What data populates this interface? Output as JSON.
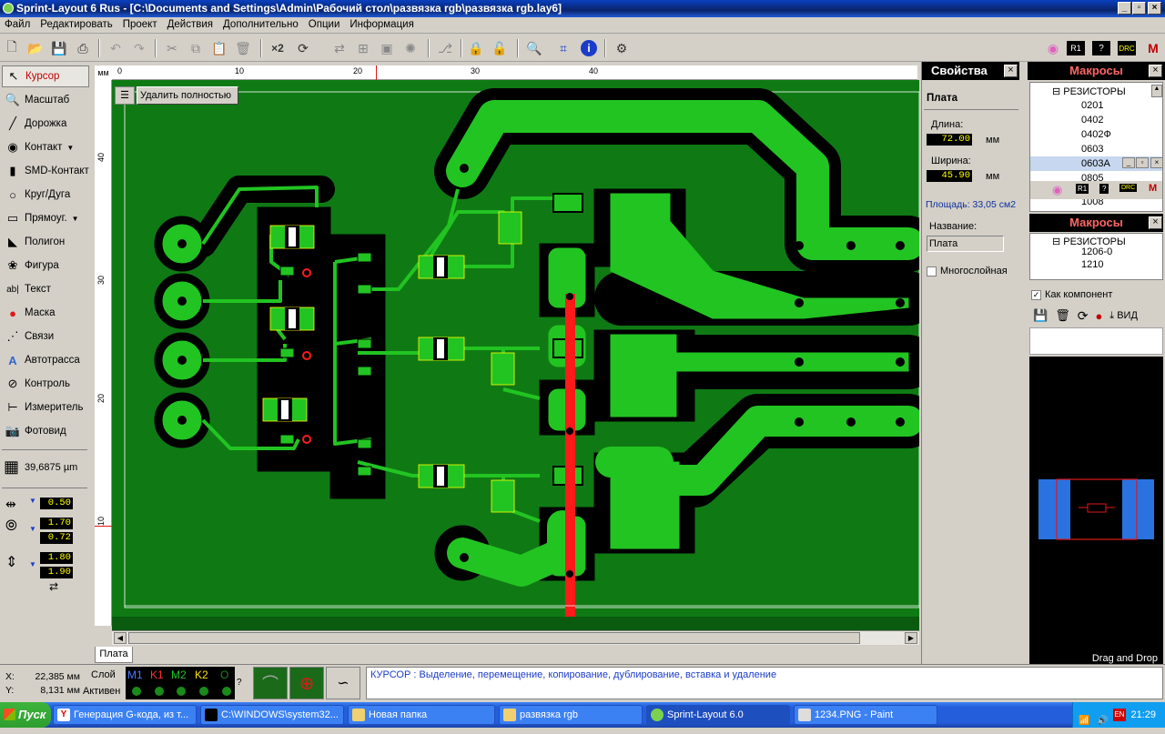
{
  "window": {
    "title": "Sprint-Layout 6 Rus - [C:\\Documents and Settings\\Admin\\Рабочий стол\\развязка rgb\\развязка rgb.lay6]"
  },
  "menu": [
    "Файл",
    "Редактировать",
    "Проект",
    "Действия",
    "Дополнительно",
    "Опции",
    "Информация"
  ],
  "tools": [
    "Курсор",
    "Масштаб",
    "Дорожка",
    "Контакт",
    "SMD-Контакт",
    "Круг/Дуга",
    "Прямоуг.",
    "Полигон",
    "Фигура",
    "Текст",
    "Маска",
    "Связи",
    "Автотрасса",
    "Контроль",
    "Измеритель",
    "Фотовид"
  ],
  "grid": {
    "value": "39,6875 µm"
  },
  "params": {
    "track_width": "0.50",
    "pad_outer": "1.70",
    "pad_inner": "0.72",
    "smd_w": "1.80",
    "smd_h": "1.90"
  },
  "ruler": {
    "unit": "мм",
    "top_ticks": [
      "0",
      "10",
      "20",
      "30",
      "40"
    ],
    "left_ticks": [
      "40",
      "30",
      "20",
      "10"
    ]
  },
  "canvas": {
    "delete_button": "Удалить полностью",
    "tab_label": "Плата"
  },
  "properties": {
    "title": "Свойства",
    "section": "Плата",
    "length_label": "Длина:",
    "length_value": "72.00",
    "width_label": "Ширина:",
    "width_value": "45.90",
    "unit": "мм",
    "area": "Площадь: 33,05 см2",
    "name_label": "Название:",
    "name_value": "Плата",
    "multilayer_label": "Многослойная"
  },
  "macros": {
    "title": "Макросы",
    "folder": "РЕЗИСТОРЫ",
    "items": [
      "0201",
      "0402",
      "0402Ф",
      "0603",
      "0603А",
      "0805",
      "1008"
    ],
    "selected": "0603А",
    "folder2": "РЕЗИСТОРЫ",
    "items2": [
      "1206",
      "1206-0",
      "1210"
    ],
    "as_component": "Как компонент",
    "view_button": "ВИД",
    "drag_drop": "Drag and Drop"
  },
  "status": {
    "x_label": "X:",
    "x_value": "22,385 мм",
    "y_label": "Y:",
    "y_value": "8,131 мм",
    "layer_label": "Слой",
    "active_label": "Активен",
    "layers": [
      "M1",
      "K1",
      "M2",
      "K2",
      "O"
    ],
    "hint": "КУРСОР  : Выделение, перемещение, копирование, дублирование, вставка и удаление"
  },
  "taskbar": {
    "start": "Пуск",
    "tasks": [
      "Генерация G-кода, из т...",
      "C:\\WINDOWS\\system32...",
      "Новая папка",
      "развязка rgb",
      "Sprint-Layout 6.0",
      "1234.PNG - Paint"
    ],
    "clock": "21:29"
  },
  "colors": {
    "board": "#0f7a14",
    "copper": "#22c422",
    "clearance": "#000000",
    "track_red": "#ff1a1a",
    "accent_title": "#0a246a"
  }
}
